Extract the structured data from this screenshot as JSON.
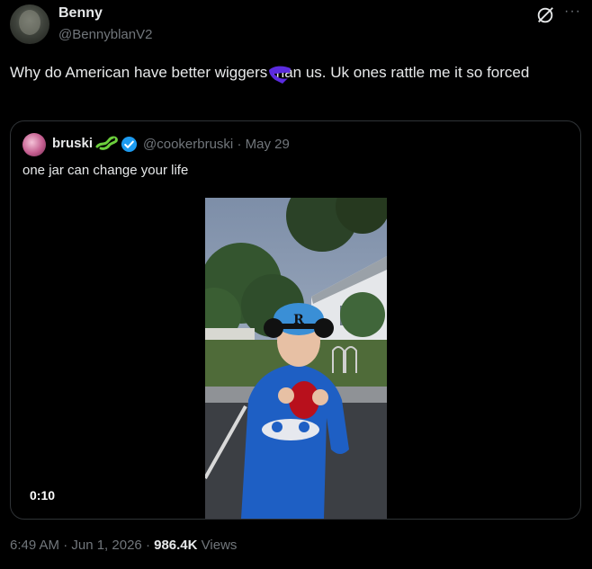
{
  "tweet": {
    "author_name": "Benny",
    "author_handle": "@BennyblanV2",
    "text": "Why do American have better wiggers than us. Uk ones rattle me it so forced",
    "timestamp": "6:49 AM · Jun 1, 2026",
    "views_count": "986.4K",
    "views_label": "Views",
    "footer_separator": "·"
  },
  "header_icons": {
    "grok": "grok-icon",
    "more": "···"
  },
  "quoted_tweet": {
    "author_name": "bruski",
    "author_handle": "@cookerbruski",
    "date": "May 29",
    "separator": "·",
    "text": "one jar can change your life",
    "video_time": "0:10",
    "badges": [
      "lizard-emoji",
      "verified-badge"
    ]
  },
  "colors": {
    "background": "#000000",
    "text_primary": "#e7e9ea",
    "text_secondary": "#71767b",
    "border": "#2f3336",
    "verified": "#1d9bf0",
    "scribble": "#5b2be0"
  }
}
